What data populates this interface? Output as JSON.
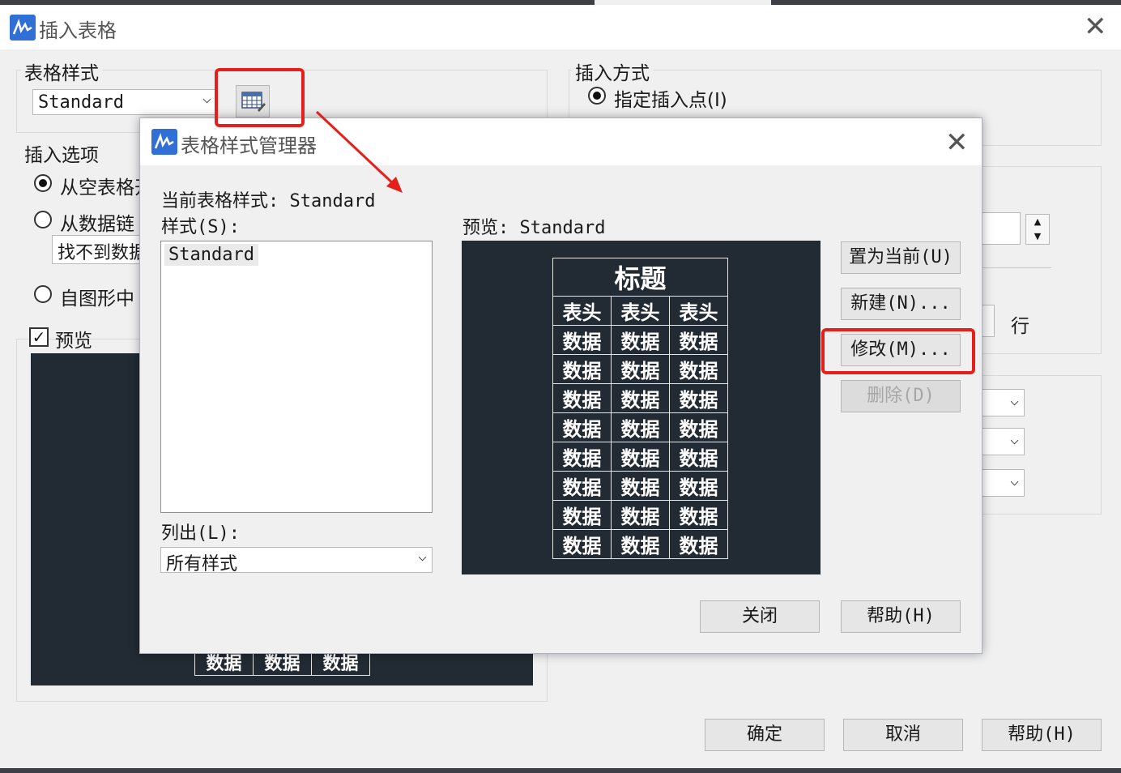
{
  "outer": {
    "title": "插入表格",
    "table_style_group": "表格样式",
    "table_style_value": "Standard",
    "insert_options_group": "插入选项",
    "opt_empty": "从空表格开",
    "opt_datalink": "从数据链",
    "datalink_value": "找不到数据",
    "opt_drawing": "自图形中",
    "preview_label": "预览",
    "insert_method_group": "插入方式",
    "method_point": "指定插入点(I)",
    "row_label": "行",
    "bg_preview_cells": [
      "数据",
      "数据",
      "数据"
    ],
    "buttons": {
      "ok": "确定",
      "cancel": "取消",
      "help": "帮助(H)"
    }
  },
  "manager": {
    "title": "表格样式管理器",
    "current_label": "当前表格样式: Standard",
    "styles_label": "样式(S):",
    "styles": [
      "Standard"
    ],
    "list_label": "列出(L):",
    "list_value": "所有样式",
    "preview_label": "预览: Standard",
    "preview_table": {
      "title": "标题",
      "header": [
        "表头",
        "表头",
        "表头"
      ],
      "rows": [
        [
          "数据",
          "数据",
          "数据"
        ],
        [
          "数据",
          "数据",
          "数据"
        ],
        [
          "数据",
          "数据",
          "数据"
        ],
        [
          "数据",
          "数据",
          "数据"
        ],
        [
          "数据",
          "数据",
          "数据"
        ],
        [
          "数据",
          "数据",
          "数据"
        ],
        [
          "数据",
          "数据",
          "数据"
        ],
        [
          "数据",
          "数据",
          "数据"
        ]
      ]
    },
    "buttons": {
      "set_current": "置为当前(U)",
      "new": "新建(N)...",
      "modify": "修改(M)...",
      "delete": "删除(D)",
      "close": "关闭",
      "help": "帮助(H)"
    }
  },
  "icons": {
    "app": "app-logo-icon",
    "table_style": "table-style-icon",
    "close": "close-icon",
    "chevron": "chevron-down-icon"
  },
  "colors": {
    "highlight": "#e5201b",
    "preview_bg": "#222a33",
    "app_icon": "#2f6fd6"
  }
}
